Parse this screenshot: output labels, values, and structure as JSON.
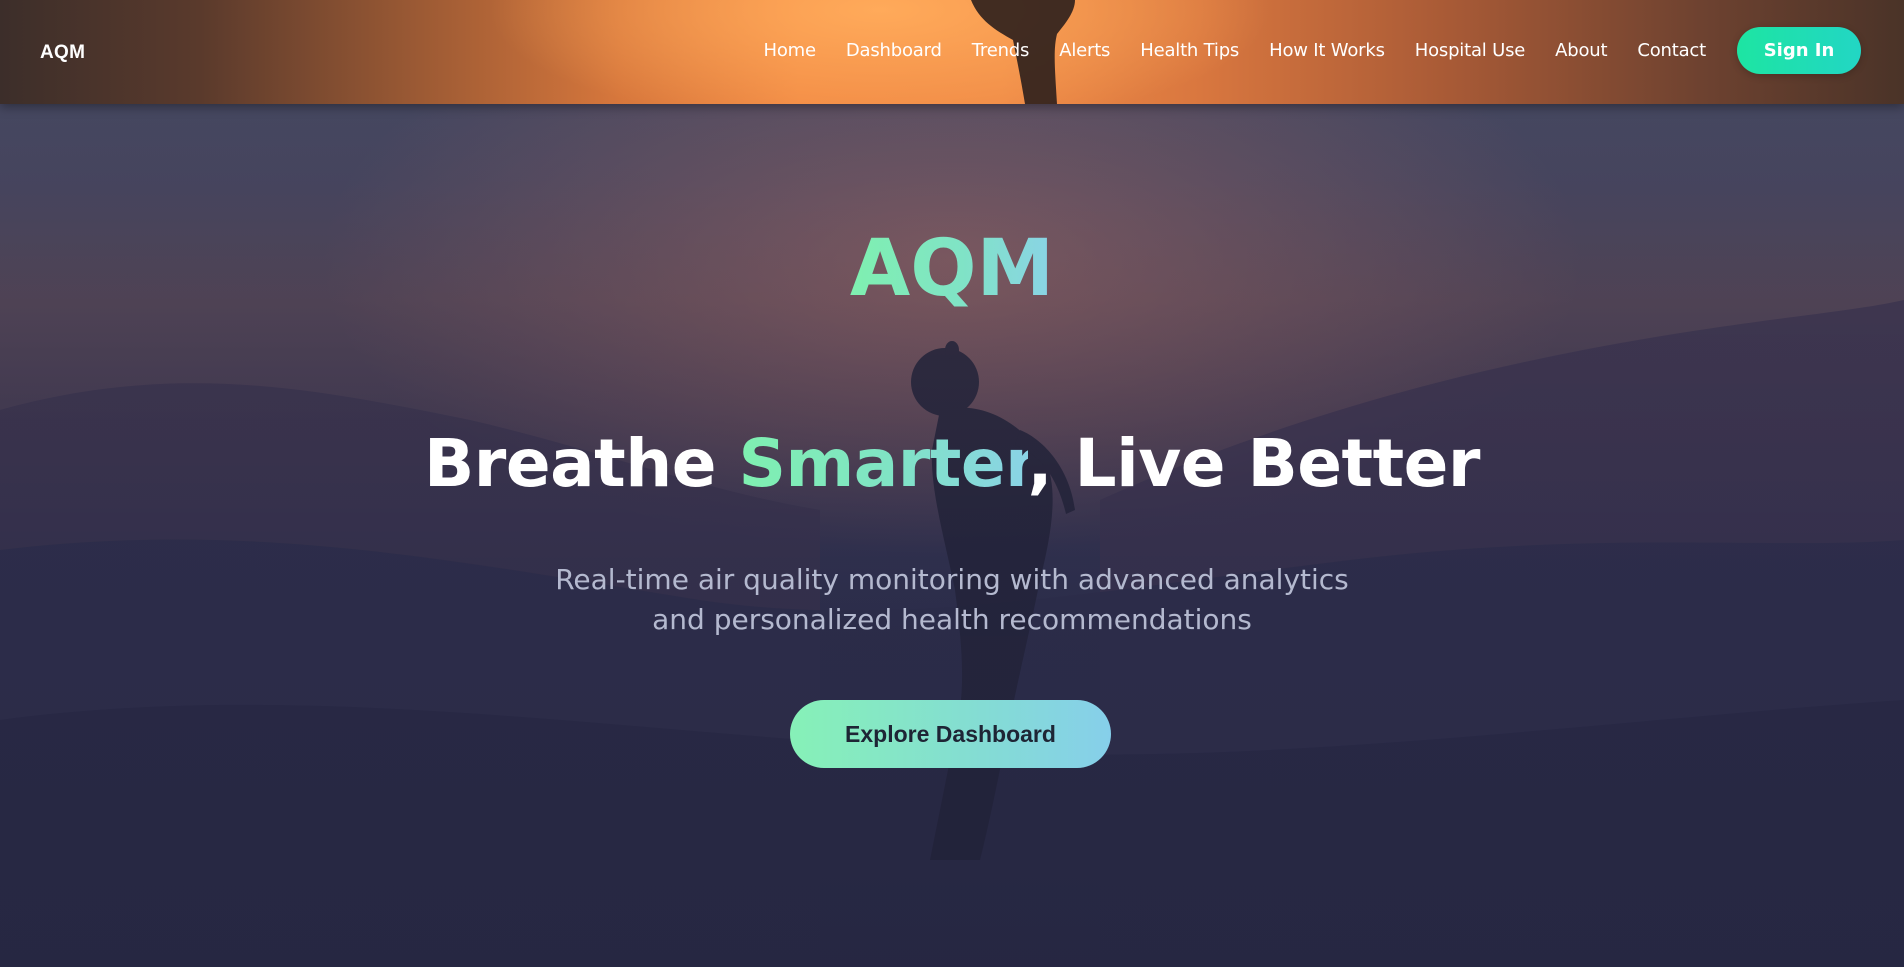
{
  "navbar": {
    "brand": "AQM",
    "links": [
      "Home",
      "Dashboard",
      "Trends",
      "Alerts",
      "Health Tips",
      "How It Works",
      "Hospital Use",
      "About",
      "Contact"
    ],
    "sign_in_label": "Sign In"
  },
  "hero": {
    "brand": "AQM",
    "headline": {
      "part1": "Breathe ",
      "highlight": "Smarter",
      "part2": ", Live Better"
    },
    "subtitle_line1": "Real-time air quality monitoring with advanced analytics",
    "subtitle_line2": "and personalized health recommendations",
    "cta_label": "Explore Dashboard"
  },
  "colors": {
    "accent_green": "#1de5a2",
    "accent_teal": "#22d6c4",
    "gradient_start": "#7ff0b0",
    "gradient_end": "#8ad3e6",
    "background": "#2a2b45"
  }
}
